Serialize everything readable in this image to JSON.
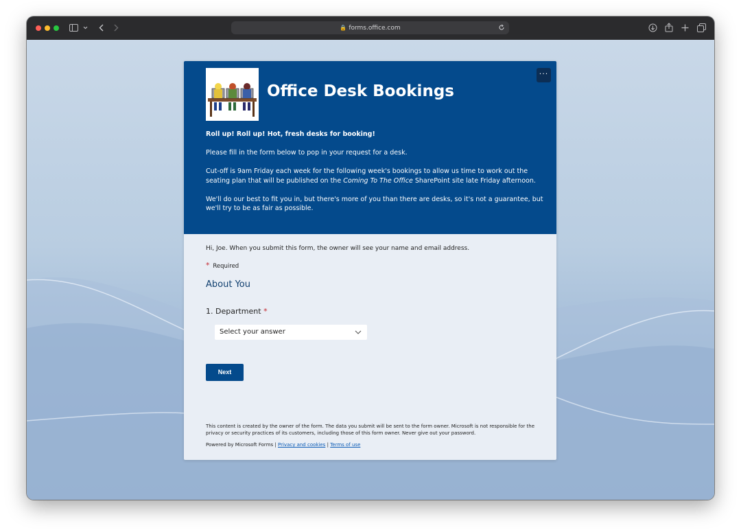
{
  "browser": {
    "url": "forms.office.com",
    "traffic_lights": [
      "#ff5f57",
      "#febc2e",
      "#28c840"
    ],
    "icons": [
      "sidebar-icon",
      "chevron-down-icon",
      "back-icon",
      "forward-icon",
      "lock-icon",
      "reload-icon",
      "download-icon",
      "share-icon",
      "new-tab-icon",
      "tab-overview-icon"
    ]
  },
  "form": {
    "title": "Office Desk Bookings",
    "more_label": "···",
    "intro_bold": "Roll up! Roll up! Hot, fresh desks for booking!",
    "intro_p2": "Please fill in the form below to pop in your request for a desk.",
    "intro_p3_a": "Cut-off is 9am Friday each week for the following week's bookings to allow us time to work out the seating plan that will be published on the ",
    "intro_p3_italic": "Coming To The Office",
    "intro_p3_b": " SharePoint site late Friday afternoon.",
    "intro_p4": "We'll do our best to fit you in, but there's more of you than there are desks, so it's not a guarantee, but we'll try to be as fair as possible.",
    "greeting": "Hi, Joe. When you submit this form, the owner will see your name and email address.",
    "required_star": "*",
    "required_label": "Required",
    "section_title": "About You",
    "question_1": {
      "number": "1.",
      "label": "Department",
      "star": "*",
      "select_placeholder": "Select your answer"
    },
    "next_label": "Next",
    "footer_disclaimer": "This content is created by the owner of the form. The data you submit will be sent to the form owner. Microsoft is not responsible for the privacy or security practices of its customers, including those of this form owner. Never give out your password.",
    "powered_by": "Powered by Microsoft Forms",
    "separator": "|",
    "privacy_link": "Privacy and cookies",
    "terms_link": "Terms of use"
  },
  "colors": {
    "header_blue": "#044a8c",
    "required_red": "#c4262e",
    "section_title": "#0f3e6e"
  }
}
